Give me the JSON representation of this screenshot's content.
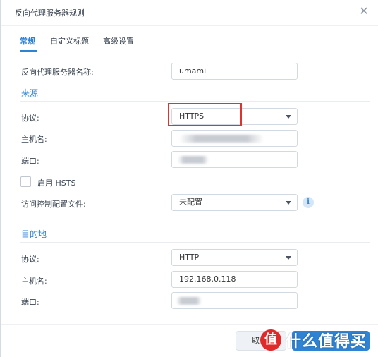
{
  "dialog": {
    "title": "反向代理服务器规则"
  },
  "tabs": [
    {
      "label": "常规",
      "active": true
    },
    {
      "label": "自定义标题",
      "active": false
    },
    {
      "label": "高级设置",
      "active": false
    }
  ],
  "form": {
    "name_label": "反向代理服务器名称:",
    "name_value": "umami",
    "source": {
      "heading": "来源",
      "protocol_label": "协议:",
      "protocol_value": "HTTPS",
      "hostname_label": "主机名:",
      "port_label": "端口:",
      "hsts_label": "启用 HSTS",
      "hsts_checked": false,
      "acl_label": "访问控制配置文件:",
      "acl_value": "未配置"
    },
    "destination": {
      "heading": "目的地",
      "protocol_label": "协议:",
      "protocol_value": "HTTP",
      "hostname_label": "主机名:",
      "hostname_value": "192.168.0.118",
      "port_label": "端口:"
    }
  },
  "footer": {
    "cancel_label": "取"
  },
  "watermark": {
    "text": "什么值得买",
    "logo": "值"
  },
  "colors": {
    "accent": "#2f83d3",
    "highlight": "#e0332d"
  }
}
